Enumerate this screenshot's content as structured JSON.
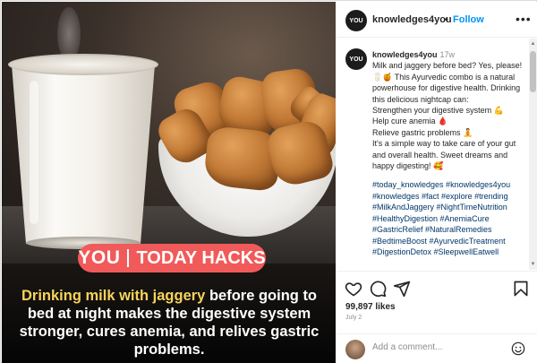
{
  "media": {
    "brand_logo": "YOU",
    "brand_tagline": "TODAY HACKS",
    "caption_highlight": "Drinking milk with jaggery",
    "caption_rest": " before going to bed at night makes the digestive system stronger, cures anemia, and relives gastric problems."
  },
  "header": {
    "avatar_text": "YOU",
    "username": "knowledges4you",
    "separator": "•",
    "follow_label": "Follow",
    "more_label": "•••"
  },
  "post": {
    "avatar_text": "YOU",
    "username": "knowledges4you",
    "time": "17w",
    "lines": [
      "Milk and jaggery before bed? Yes, please! 🥛🍯 This Ayurvedic combo is a natural powerhouse for digestive health. Drinking this delicious nightcap can:",
      "Strengthen your digestive system 💪",
      "Help cure anemia 🩸",
      "Relieve gastric problems 🧘",
      "It's a simple way to take care of your gut and overall health. Sweet dreams and happy digesting! 🥰"
    ],
    "hashtags": "#today_knowledges #knowledges4you #knowledges #fact #explore #trending #MilkAndJaggery #NightTimeNutrition #HealthyDigestion #AnemiaCure #GastricRelief #NaturalRemedies #BedtimeBoost #AyurvedicTreatment #DigestionDetox #SleepwellEatwell"
  },
  "actions": {
    "likes": "99,897 likes",
    "date": "July 2"
  },
  "add_comment": {
    "placeholder": "Add a comment..."
  },
  "icons": [
    "heart-icon",
    "comment-icon",
    "share-icon",
    "bookmark-icon",
    "emoji-icon",
    "more-icon"
  ]
}
